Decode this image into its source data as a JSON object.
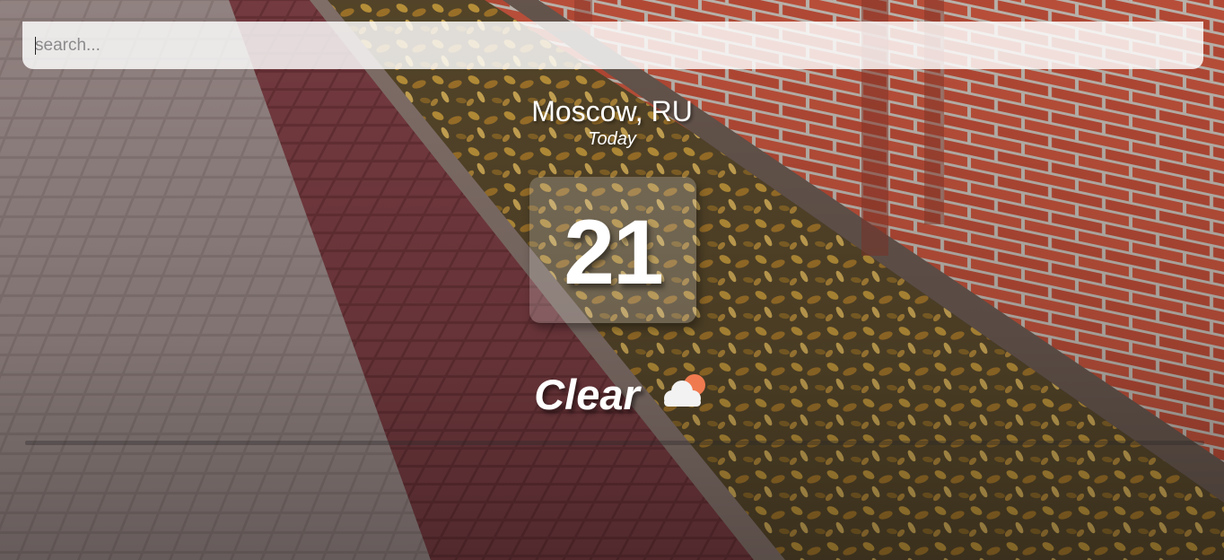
{
  "search": {
    "placeholder": "search...",
    "value": ""
  },
  "location": {
    "city": "Moscow, RU",
    "date": "Today"
  },
  "current": {
    "temperature": "21",
    "condition": "Clear",
    "icon": "cloud-sun-icon"
  },
  "colors": {
    "text": "#ffffff",
    "search_bg": "#ffffffd1",
    "sun": "#f07a4f",
    "cloud": "#f2f2f2"
  }
}
